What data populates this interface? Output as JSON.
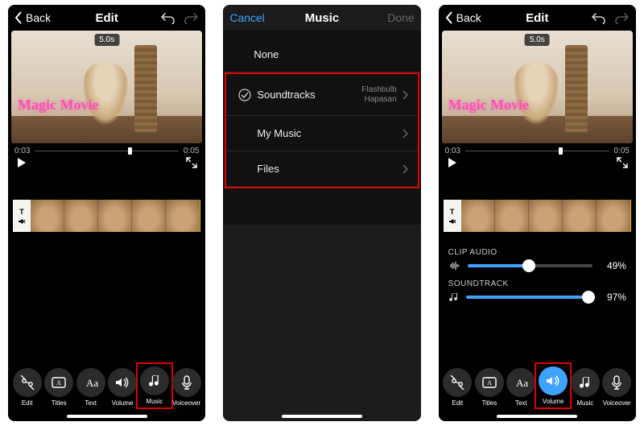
{
  "panel1": {
    "back": "Back",
    "title": "Edit",
    "overlay_text": "Magic Movie",
    "clip_tag": "5.0s",
    "time_left": "0:03",
    "time_right": "0:05",
    "tools": [
      "Edit",
      "Titles",
      "Text",
      "Volume",
      "Music",
      "Voiceover"
    ],
    "highlight_tool_index": 4
  },
  "panel2": {
    "cancel": "Cancel",
    "title": "Music",
    "done": "Done",
    "rows": [
      {
        "label": "None",
        "selected": false,
        "sub": ""
      },
      {
        "label": "Soundtracks",
        "selected": true,
        "sub": "Flashbulb\nHapasan"
      },
      {
        "label": "My Music",
        "selected": false,
        "sub": ""
      },
      {
        "label": "Files",
        "selected": false,
        "sub": ""
      }
    ],
    "highlight_rows": [
      1,
      2,
      3
    ]
  },
  "panel3": {
    "back": "Back",
    "title": "Edit",
    "overlay_text": "Magic Movie",
    "clip_tag": "5.0s",
    "time_left": "0:03",
    "time_right": "0:05",
    "clip_audio_label": "CLIP AUDIO",
    "clip_audio_pct": "49%",
    "clip_audio_val": 49,
    "soundtrack_label": "SOUNDTRACK",
    "soundtrack_pct": "97%",
    "soundtrack_val": 97,
    "tools": [
      "Edit",
      "Titles",
      "Text",
      "Volume",
      "Music",
      "Voiceover"
    ],
    "highlight_tool_index": 3
  }
}
